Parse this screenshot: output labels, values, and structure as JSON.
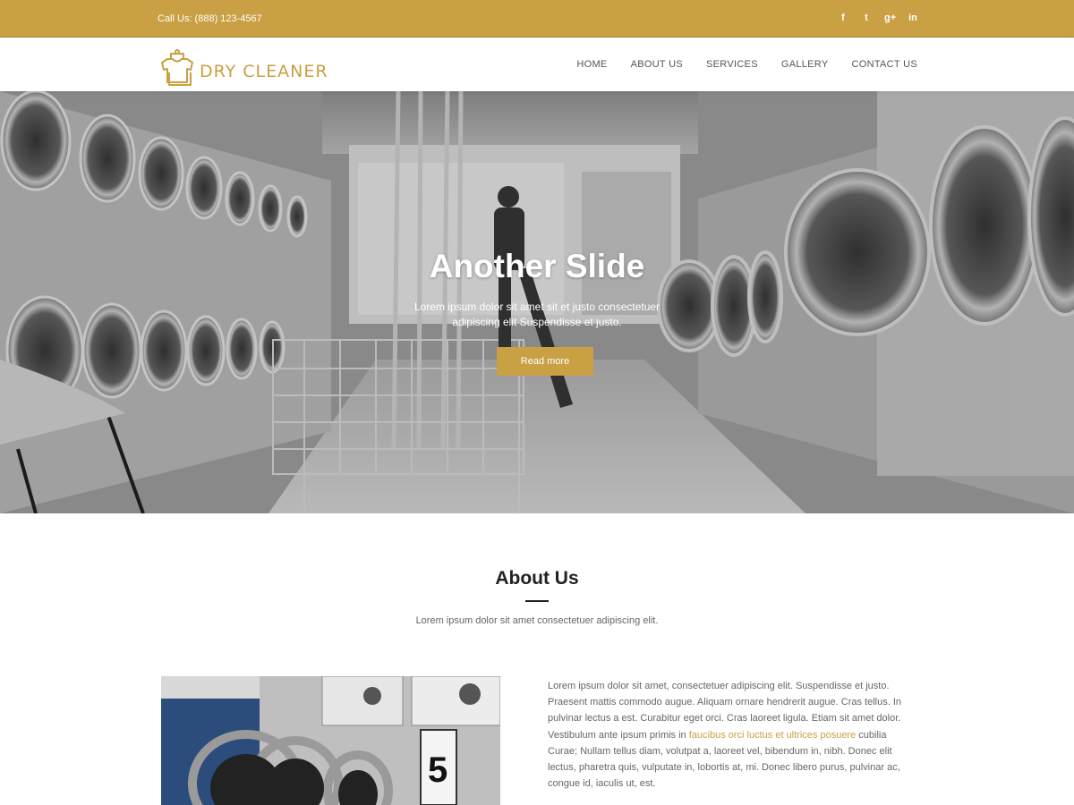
{
  "topbar": {
    "call": "Call Us: (888) 123-4567",
    "social": [
      {
        "icon": "facebook-icon",
        "glyph": "f"
      },
      {
        "icon": "twitter-icon",
        "glyph": "t"
      },
      {
        "icon": "google-plus-icon",
        "glyph": "g+"
      },
      {
        "icon": "linkedin-icon",
        "glyph": "in"
      }
    ]
  },
  "header": {
    "logo_text": "DRY CLEANER",
    "nav": [
      "HOME",
      "ABOUT US",
      "SERVICES",
      "GALLERY",
      "CONTACT US"
    ]
  },
  "hero": {
    "title": "Another Slide",
    "text": "Lorem ipsum dolor sit amet sit et justo consectetuer adipiscing elit Suspendisse et justo.",
    "button": "Read more"
  },
  "about": {
    "title": "About Us",
    "subtitle": "Lorem ipsum dolor sit amet consectetuer adipiscing elit.",
    "para_before": "Lorem ipsum dolor sit amet, consectetuer adipiscing elit. Suspendisse et justo. Praesent mattis commodo augue. Aliquam ornare hendrerit augue. Cras tellus. In pulvinar lectus a est. Curabitur eget orci. Cras laoreet ligula. Etiam sit amet dolor. Vestibulum ante ipsum primis in ",
    "para_link": "faucibus orci luctus et ultrices posuere",
    "para_after": " cubilia Curae; Nullam tellus diam, volutpat a, laoreet vel, bibendum in, nibh. Donec elit lectus, pharetra quis, vulputate in, lobortis at, mi. Donec libero purus, pulvinar ac, congue id, iaculis ut, est.",
    "machine_number": "5"
  },
  "colors": {
    "accent": "#c9a043",
    "text": "#666666",
    "heading": "#222222"
  }
}
